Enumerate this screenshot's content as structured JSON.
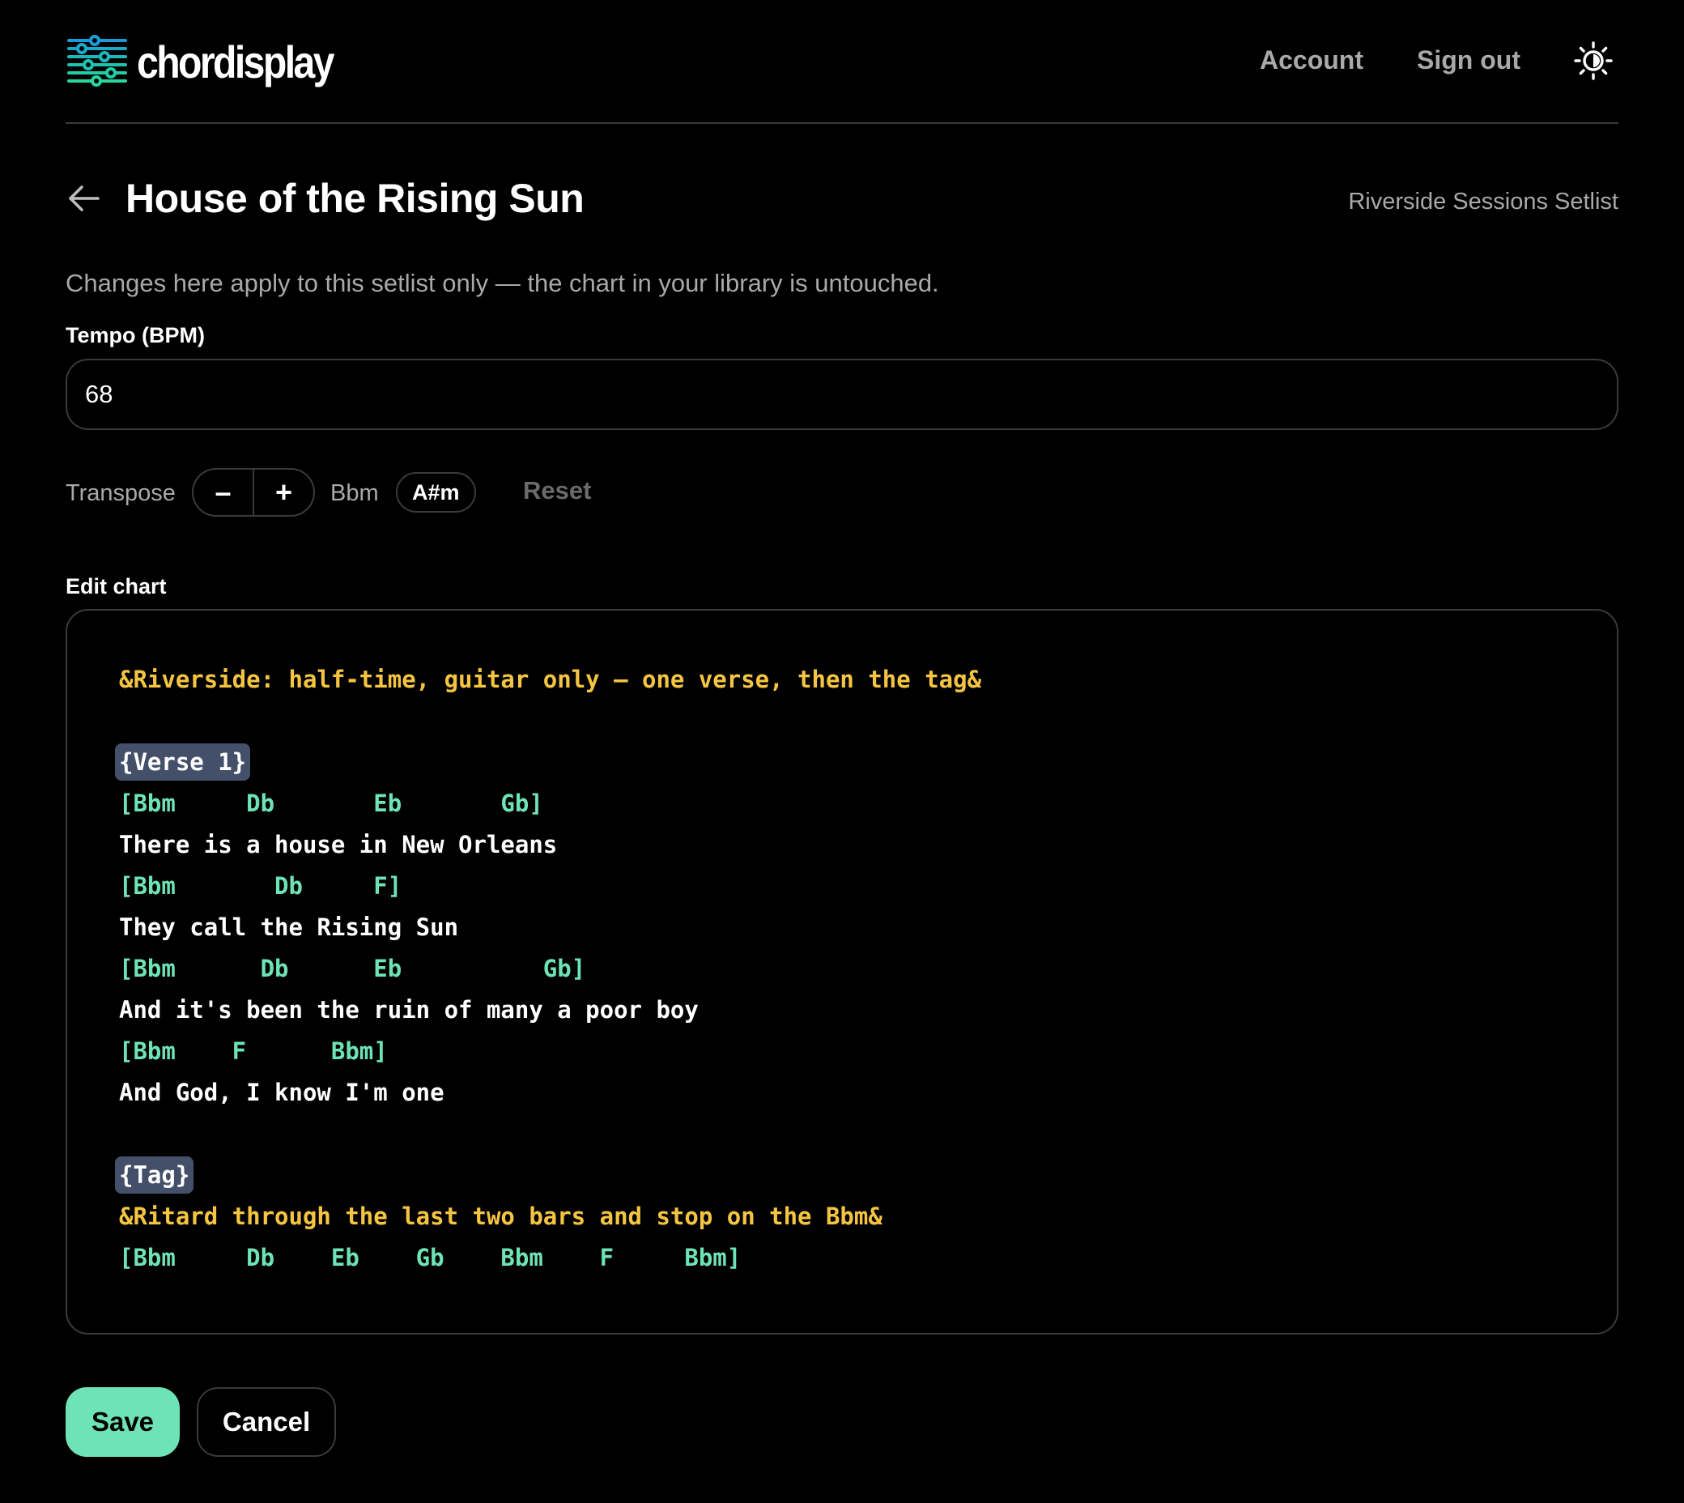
{
  "header": {
    "logo_text": "chordisplay",
    "nav": {
      "account": "Account",
      "sign_out": "Sign out"
    },
    "theme_icon": "sun-icon"
  },
  "song": {
    "title": "House of the Rising Sun",
    "setlist_name": "Riverside Sessions Setlist",
    "note": "Changes here apply to this setlist only — the chart in your library is untouched."
  },
  "tempo": {
    "label": "Tempo (BPM)",
    "value": "68"
  },
  "transpose": {
    "label": "Transpose",
    "minus": "–",
    "plus": "+",
    "original_key": "Bbm",
    "new_key": "A#m",
    "reset": "Reset"
  },
  "editor": {
    "label": "Edit chart",
    "lines": [
      {
        "type": "note",
        "text": "&Riverside: half-time, guitar only — one verse, then the tag&"
      },
      {
        "type": "blank",
        "text": ""
      },
      {
        "type": "section",
        "text": "{Verse 1}"
      },
      {
        "type": "chord",
        "text": "[Bbm     Db       Eb       Gb]"
      },
      {
        "type": "lyric",
        "text": "There is a house in New Orleans"
      },
      {
        "type": "chord",
        "text": "[Bbm       Db     F]"
      },
      {
        "type": "lyric",
        "text": "They call the Rising Sun"
      },
      {
        "type": "chord",
        "text": "[Bbm      Db      Eb          Gb]"
      },
      {
        "type": "lyric",
        "text": "And it's been the ruin of many a poor boy"
      },
      {
        "type": "chord",
        "text": "[Bbm    F      Bbm]"
      },
      {
        "type": "lyric",
        "text": "And God, I know I'm one"
      },
      {
        "type": "blank",
        "text": ""
      },
      {
        "type": "section",
        "text": "{Tag}"
      },
      {
        "type": "note",
        "text": "&Ritard through the last two bars and stop on the Bbm&"
      },
      {
        "type": "chord",
        "text": "[Bbm     Db    Eb    Gb    Bbm    F     Bbm]"
      }
    ]
  },
  "actions": {
    "save": "Save",
    "cancel": "Cancel"
  },
  "colors": {
    "accent": "#6fe3b8",
    "note": "#f5c542",
    "section_bg": "#445069",
    "border": "#3a3a3a",
    "muted": "#a9a9a9"
  }
}
